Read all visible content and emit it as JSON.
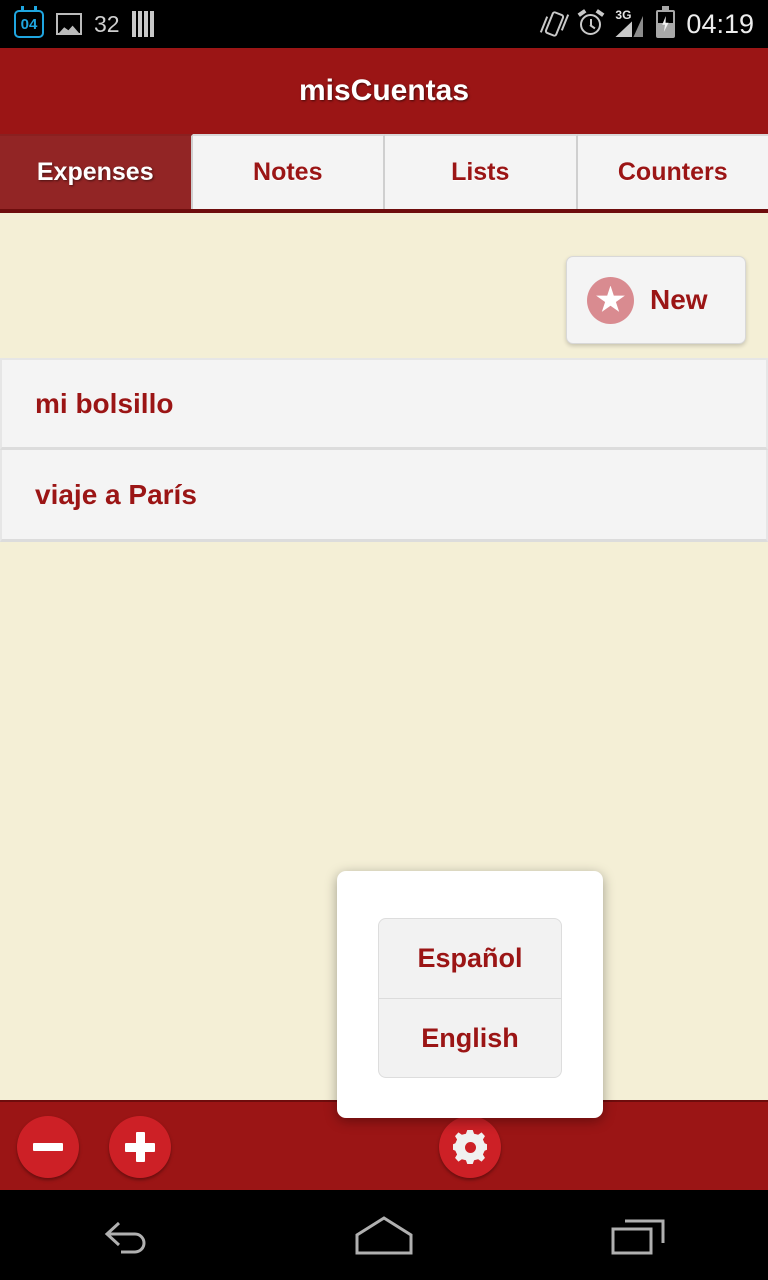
{
  "status_bar": {
    "calendar_day": "04",
    "photo_count": "32",
    "icons": [
      "calendar-icon",
      "image-icon",
      "bars-icon",
      "vibrate-icon",
      "alarm-icon",
      "signal-3g-icon",
      "battery-charging-icon"
    ],
    "network": "3G",
    "time": "04:19"
  },
  "app": {
    "title": "misCuentas",
    "accent_red": "#9B1515",
    "background": "#F4EFD6"
  },
  "tabs": [
    {
      "label": "Expenses",
      "active": true
    },
    {
      "label": "Notes",
      "active": false
    },
    {
      "label": "Lists",
      "active": false
    },
    {
      "label": "Counters",
      "active": false
    }
  ],
  "toolbar": {
    "new_label": "New",
    "new_icon": "star-icon"
  },
  "accounts": [
    {
      "name": "mi bolsillo"
    },
    {
      "name": "viaje a París"
    }
  ],
  "bottom_bar": {
    "minus_label": "−",
    "plus_label": "+",
    "settings_icon": "gear-icon",
    "button_color": "#CD2026"
  },
  "dialog": {
    "options": [
      {
        "label": "Español"
      },
      {
        "label": "English"
      }
    ]
  },
  "navigation_bar": {
    "back": "back-icon",
    "home": "home-icon",
    "recents": "recent-apps-icon"
  }
}
